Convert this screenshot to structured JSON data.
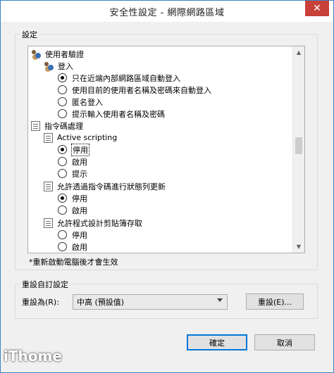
{
  "window": {
    "title": "安全性設定 - 網際網路區域",
    "close_label": "✕"
  },
  "settings_group": {
    "legend": "設定"
  },
  "tree": {
    "user_auth": "使用者驗證",
    "logon": "登入",
    "logon_options": [
      {
        "label": "只在近端內部網路區域自動登入",
        "checked": true
      },
      {
        "label": "使用目前的使用者名稱及密碼來自動登入",
        "checked": false
      },
      {
        "label": "匿名登入",
        "checked": false
      },
      {
        "label": "提示輸入使用者名稱及密碼",
        "checked": false
      }
    ],
    "scripting": "指令碼處理",
    "active_scripting": "Active scripting",
    "active_scripting_options": [
      {
        "label": "停用",
        "checked": true
      },
      {
        "label": "啟用",
        "checked": false
      },
      {
        "label": "提示",
        "checked": false
      }
    ],
    "status_bar_update": "允許透過指令碼進行狀態列更新",
    "status_bar_options": [
      {
        "label": "停用",
        "checked": true
      },
      {
        "label": "啟用",
        "checked": false
      }
    ],
    "clipboard_access": "允許程式設計剪貼簿存取",
    "clipboard_options": [
      {
        "label": "停用",
        "checked": false
      },
      {
        "label": "啟用",
        "checked": false
      }
    ]
  },
  "note": "*重新啟動電腦後才會生效",
  "reset_group": {
    "legend": "重設自訂設定",
    "reset_to_label": "重設為(R):",
    "combo_value": "中高 (預設值)",
    "reset_button": "重設(E)..."
  },
  "footer": {
    "ok_button": "確定",
    "cancel_button": "取消"
  },
  "watermark": "iThome",
  "icons": {
    "users": "users-icon",
    "script": "script-icon",
    "scroll_up": "▲",
    "scroll_down": "▼"
  }
}
